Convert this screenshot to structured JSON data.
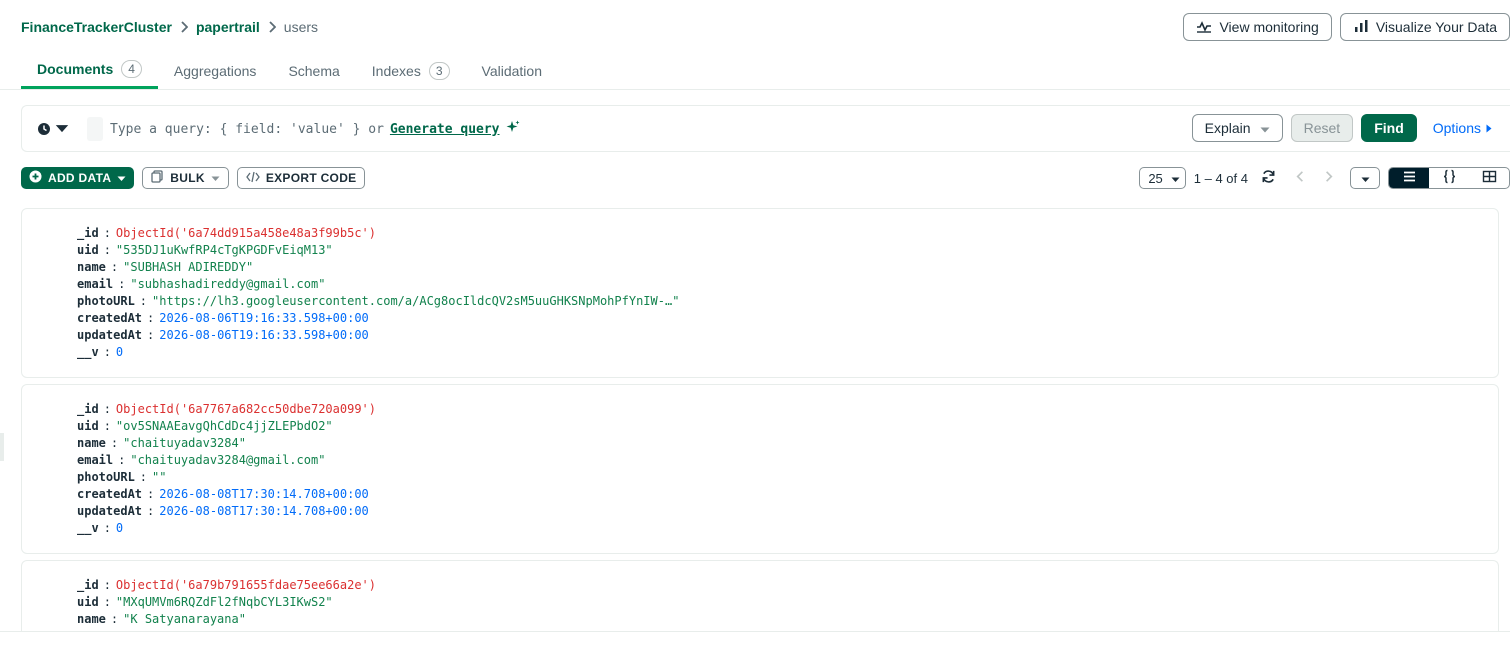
{
  "breadcrumb": {
    "cluster": "FinanceTrackerCluster",
    "database": "papertrail",
    "collection": "users"
  },
  "top_actions": {
    "monitoring": "View monitoring",
    "visualize": "Visualize Your Data"
  },
  "tabs": [
    {
      "label": "Documents",
      "count": "4"
    },
    {
      "label": "Aggregations",
      "count": ""
    },
    {
      "label": "Schema",
      "count": ""
    },
    {
      "label": "Indexes",
      "count": "3"
    },
    {
      "label": "Validation",
      "count": ""
    }
  ],
  "query": {
    "placeholder_prefix": "Type a query: { field: 'value' } or",
    "generate_link": "Generate query",
    "explain": "Explain",
    "reset": "Reset",
    "find": "Find",
    "options": "Options"
  },
  "toolbar": {
    "add_data": "ADD DATA",
    "bulk": "BULK",
    "export_code": "EXPORT CODE"
  },
  "pager": {
    "page_size": "25",
    "range": "1 – 4 of 4"
  },
  "documents": [
    {
      "fields": [
        {
          "key": "_id",
          "value": "ObjectId('6a74dd915a458e48a3f99b5c')",
          "type": "oid"
        },
        {
          "key": "uid",
          "value": "\"535DJ1uKwfRP4cTgKPGDFvEiqM13\"",
          "type": "str"
        },
        {
          "key": "name",
          "value": "\"SUBHASH ADIREDDY\"",
          "type": "str"
        },
        {
          "key": "email",
          "value": "\"subhashadireddy@gmail.com\"",
          "type": "str"
        },
        {
          "key": "photoURL",
          "value": "\"https://lh3.googleusercontent.com/a/ACg8ocIldcQV2sM5uuGHKSNpMohPfYnIW-…\"",
          "type": "str"
        },
        {
          "key": "createdAt",
          "value": "2026-08-06T19:16:33.598+00:00",
          "type": "date"
        },
        {
          "key": "updatedAt",
          "value": "2026-08-06T19:16:33.598+00:00",
          "type": "date"
        },
        {
          "key": "__v",
          "value": "0",
          "type": "num"
        }
      ]
    },
    {
      "fields": [
        {
          "key": "_id",
          "value": "ObjectId('6a7767a682cc50dbe720a099')",
          "type": "oid"
        },
        {
          "key": "uid",
          "value": "\"ov5SNAAEavgQhCdDc4jjZLEPbdO2\"",
          "type": "str"
        },
        {
          "key": "name",
          "value": "\"chaituyadav3284\"",
          "type": "str"
        },
        {
          "key": "email",
          "value": "\"chaituyadav3284@gmail.com\"",
          "type": "str"
        },
        {
          "key": "photoURL",
          "value": "\"\"",
          "type": "str"
        },
        {
          "key": "createdAt",
          "value": "2026-08-08T17:30:14.708+00:00",
          "type": "date"
        },
        {
          "key": "updatedAt",
          "value": "2026-08-08T17:30:14.708+00:00",
          "type": "date"
        },
        {
          "key": "__v",
          "value": "0",
          "type": "num"
        }
      ]
    },
    {
      "fields": [
        {
          "key": "_id",
          "value": "ObjectId('6a79b791655fdae75ee66a2e')",
          "type": "oid"
        },
        {
          "key": "uid",
          "value": "\"MXqUMVm6RQZdFl2fNqbCYL3IKwS2\"",
          "type": "str"
        },
        {
          "key": "name",
          "value": "\"K Satyanarayana\"",
          "type": "str"
        }
      ]
    }
  ]
}
